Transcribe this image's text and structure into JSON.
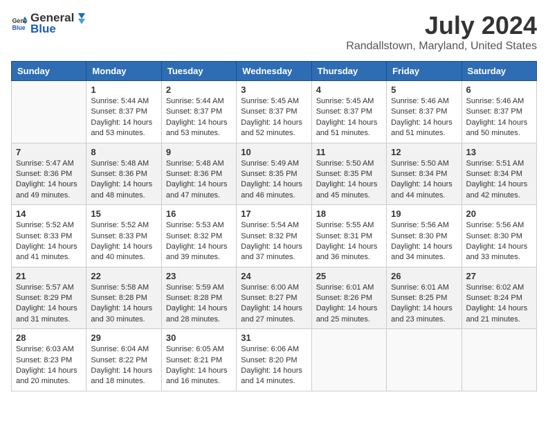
{
  "header": {
    "logo_general": "General",
    "logo_blue": "Blue",
    "month_year": "July 2024",
    "location": "Randallstown, Maryland, United States"
  },
  "weekdays": [
    "Sunday",
    "Monday",
    "Tuesday",
    "Wednesday",
    "Thursday",
    "Friday",
    "Saturday"
  ],
  "weeks": [
    [
      {
        "day": "",
        "empty": true
      },
      {
        "day": "1",
        "sunrise": "Sunrise: 5:44 AM",
        "sunset": "Sunset: 8:37 PM",
        "daylight": "Daylight: 14 hours and 53 minutes."
      },
      {
        "day": "2",
        "sunrise": "Sunrise: 5:44 AM",
        "sunset": "Sunset: 8:37 PM",
        "daylight": "Daylight: 14 hours and 53 minutes."
      },
      {
        "day": "3",
        "sunrise": "Sunrise: 5:45 AM",
        "sunset": "Sunset: 8:37 PM",
        "daylight": "Daylight: 14 hours and 52 minutes."
      },
      {
        "day": "4",
        "sunrise": "Sunrise: 5:45 AM",
        "sunset": "Sunset: 8:37 PM",
        "daylight": "Daylight: 14 hours and 51 minutes."
      },
      {
        "day": "5",
        "sunrise": "Sunrise: 5:46 AM",
        "sunset": "Sunset: 8:37 PM",
        "daylight": "Daylight: 14 hours and 51 minutes."
      },
      {
        "day": "6",
        "sunrise": "Sunrise: 5:46 AM",
        "sunset": "Sunset: 8:37 PM",
        "daylight": "Daylight: 14 hours and 50 minutes."
      }
    ],
    [
      {
        "day": "7",
        "sunrise": "Sunrise: 5:47 AM",
        "sunset": "Sunset: 8:36 PM",
        "daylight": "Daylight: 14 hours and 49 minutes."
      },
      {
        "day": "8",
        "sunrise": "Sunrise: 5:48 AM",
        "sunset": "Sunset: 8:36 PM",
        "daylight": "Daylight: 14 hours and 48 minutes."
      },
      {
        "day": "9",
        "sunrise": "Sunrise: 5:48 AM",
        "sunset": "Sunset: 8:36 PM",
        "daylight": "Daylight: 14 hours and 47 minutes."
      },
      {
        "day": "10",
        "sunrise": "Sunrise: 5:49 AM",
        "sunset": "Sunset: 8:35 PM",
        "daylight": "Daylight: 14 hours and 46 minutes."
      },
      {
        "day": "11",
        "sunrise": "Sunrise: 5:50 AM",
        "sunset": "Sunset: 8:35 PM",
        "daylight": "Daylight: 14 hours and 45 minutes."
      },
      {
        "day": "12",
        "sunrise": "Sunrise: 5:50 AM",
        "sunset": "Sunset: 8:34 PM",
        "daylight": "Daylight: 14 hours and 44 minutes."
      },
      {
        "day": "13",
        "sunrise": "Sunrise: 5:51 AM",
        "sunset": "Sunset: 8:34 PM",
        "daylight": "Daylight: 14 hours and 42 minutes."
      }
    ],
    [
      {
        "day": "14",
        "sunrise": "Sunrise: 5:52 AM",
        "sunset": "Sunset: 8:33 PM",
        "daylight": "Daylight: 14 hours and 41 minutes."
      },
      {
        "day": "15",
        "sunrise": "Sunrise: 5:52 AM",
        "sunset": "Sunset: 8:33 PM",
        "daylight": "Daylight: 14 hours and 40 minutes."
      },
      {
        "day": "16",
        "sunrise": "Sunrise: 5:53 AM",
        "sunset": "Sunset: 8:32 PM",
        "daylight": "Daylight: 14 hours and 39 minutes."
      },
      {
        "day": "17",
        "sunrise": "Sunrise: 5:54 AM",
        "sunset": "Sunset: 8:32 PM",
        "daylight": "Daylight: 14 hours and 37 minutes."
      },
      {
        "day": "18",
        "sunrise": "Sunrise: 5:55 AM",
        "sunset": "Sunset: 8:31 PM",
        "daylight": "Daylight: 14 hours and 36 minutes."
      },
      {
        "day": "19",
        "sunrise": "Sunrise: 5:56 AM",
        "sunset": "Sunset: 8:30 PM",
        "daylight": "Daylight: 14 hours and 34 minutes."
      },
      {
        "day": "20",
        "sunrise": "Sunrise: 5:56 AM",
        "sunset": "Sunset: 8:30 PM",
        "daylight": "Daylight: 14 hours and 33 minutes."
      }
    ],
    [
      {
        "day": "21",
        "sunrise": "Sunrise: 5:57 AM",
        "sunset": "Sunset: 8:29 PM",
        "daylight": "Daylight: 14 hours and 31 minutes."
      },
      {
        "day": "22",
        "sunrise": "Sunrise: 5:58 AM",
        "sunset": "Sunset: 8:28 PM",
        "daylight": "Daylight: 14 hours and 30 minutes."
      },
      {
        "day": "23",
        "sunrise": "Sunrise: 5:59 AM",
        "sunset": "Sunset: 8:28 PM",
        "daylight": "Daylight: 14 hours and 28 minutes."
      },
      {
        "day": "24",
        "sunrise": "Sunrise: 6:00 AM",
        "sunset": "Sunset: 8:27 PM",
        "daylight": "Daylight: 14 hours and 27 minutes."
      },
      {
        "day": "25",
        "sunrise": "Sunrise: 6:01 AM",
        "sunset": "Sunset: 8:26 PM",
        "daylight": "Daylight: 14 hours and 25 minutes."
      },
      {
        "day": "26",
        "sunrise": "Sunrise: 6:01 AM",
        "sunset": "Sunset: 8:25 PM",
        "daylight": "Daylight: 14 hours and 23 minutes."
      },
      {
        "day": "27",
        "sunrise": "Sunrise: 6:02 AM",
        "sunset": "Sunset: 8:24 PM",
        "daylight": "Daylight: 14 hours and 21 minutes."
      }
    ],
    [
      {
        "day": "28",
        "sunrise": "Sunrise: 6:03 AM",
        "sunset": "Sunset: 8:23 PM",
        "daylight": "Daylight: 14 hours and 20 minutes."
      },
      {
        "day": "29",
        "sunrise": "Sunrise: 6:04 AM",
        "sunset": "Sunset: 8:22 PM",
        "daylight": "Daylight: 14 hours and 18 minutes."
      },
      {
        "day": "30",
        "sunrise": "Sunrise: 6:05 AM",
        "sunset": "Sunset: 8:21 PM",
        "daylight": "Daylight: 14 hours and 16 minutes."
      },
      {
        "day": "31",
        "sunrise": "Sunrise: 6:06 AM",
        "sunset": "Sunset: 8:20 PM",
        "daylight": "Daylight: 14 hours and 14 minutes."
      },
      {
        "day": "",
        "empty": true
      },
      {
        "day": "",
        "empty": true
      },
      {
        "day": "",
        "empty": true
      }
    ]
  ]
}
